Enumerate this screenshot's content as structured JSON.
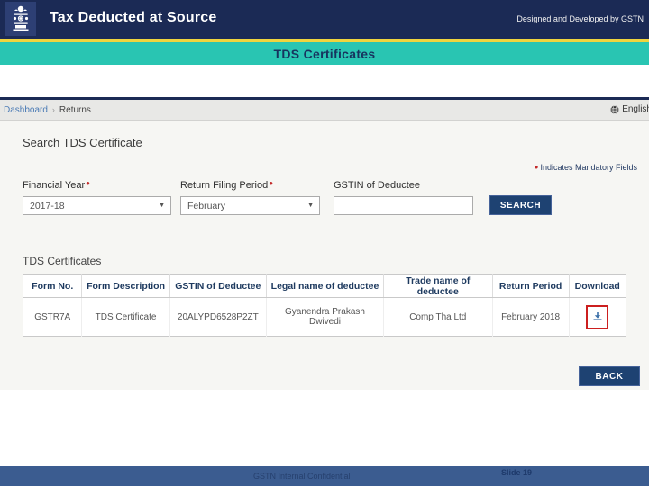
{
  "header": {
    "title": "Tax Deducted at Source",
    "credit": "Designed and Developed by GSTN"
  },
  "banner": {
    "title": "TDS Certificates"
  },
  "breadcrumb": {
    "dashboard": "Dashboard",
    "separator": "›",
    "current": "Returns",
    "language": "English"
  },
  "search_section": {
    "heading": "Search TDS Certificate",
    "mandatory_note": "Indicates Mandatory Fields",
    "fields": [
      {
        "label": "Financial Year",
        "required": true,
        "value": "2017-18",
        "type": "select"
      },
      {
        "label": "Return Filing Period",
        "required": true,
        "value": "February",
        "type": "select"
      },
      {
        "label": "GSTIN of Deductee",
        "required": false,
        "value": "",
        "type": "text"
      }
    ],
    "search_button": "SEARCH"
  },
  "certificates_section": {
    "heading": "TDS Certificates",
    "table": {
      "headers": [
        "Form No.",
        "Form Description",
        "GSTIN of Deductee",
        "Legal name of deductee",
        "Trade name of deductee",
        "Return Period",
        "Download"
      ],
      "rows": [
        {
          "form_no": "GSTR7A",
          "form_description": "TDS Certificate",
          "gstin": "20ALYPD6528P2ZT",
          "legal_name": "Gyanendra Prakash Dwivedi",
          "trade_name": "Comp Tha Ltd",
          "return_period": "February 2018",
          "download_icon": "download-icon"
        }
      ]
    },
    "back_button": "BACK"
  },
  "footer": {
    "left_text": "GSTN Internal Confidential",
    "right_text": "Slide 19"
  },
  "colors": {
    "header_navy": "#1b2a55",
    "gold_strip": "#f0d43e",
    "banner_teal": "#29c5b2",
    "banner_text": "#17335e",
    "button_navy": "#1e4272",
    "mandatory_red": "#c32a2a",
    "download_highlight_red": "#cc1f1f",
    "footer_blue": "#3b5c90",
    "link_blue": "#4a7ab5"
  }
}
